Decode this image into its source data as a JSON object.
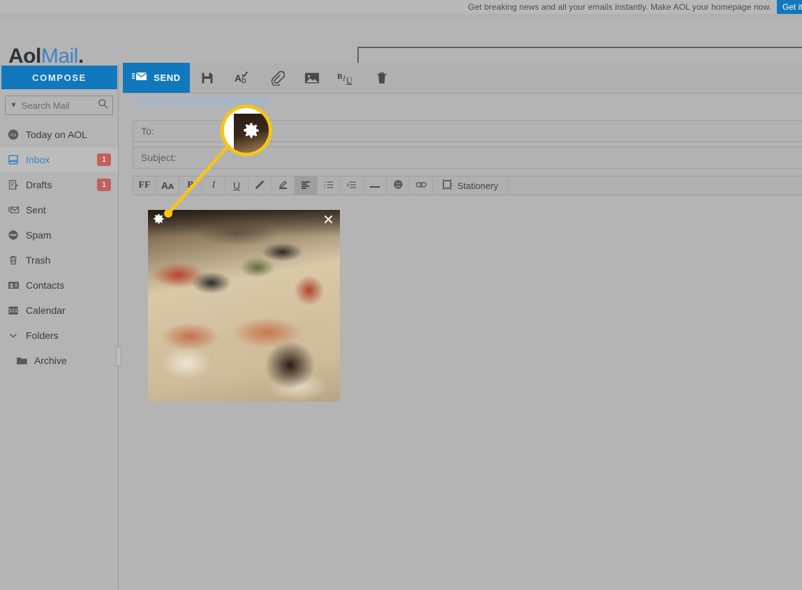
{
  "promo": {
    "text": "Get breaking news and all your emails instantly. Make AOL your homepage now.",
    "button_label": "Get it now",
    "button_color": "#1278bd"
  },
  "brand": {
    "name_primary": "Aol",
    "name_secondary": "Mail",
    "period": ".",
    "accent_color": "#3f83c6"
  },
  "header": {
    "search_value": "",
    "search_placeholder": ""
  },
  "sidebar": {
    "compose_label": "COMPOSE",
    "search": {
      "placeholder": "Search Mail",
      "value": "",
      "chevron": "chevron-down-icon",
      "icon": "search-icon"
    },
    "items": [
      {
        "label": "Today on AOL",
        "icon": "aol-circle-icon",
        "badge": "",
        "active": false
      },
      {
        "label": "Inbox",
        "icon": "inbox-icon",
        "badge": "1",
        "active": true
      },
      {
        "label": "Drafts",
        "icon": "drafts-icon",
        "badge": "1",
        "active": false
      },
      {
        "label": "Sent",
        "icon": "sent-icon",
        "badge": "",
        "active": false
      },
      {
        "label": "Spam",
        "icon": "spam-icon",
        "badge": "",
        "active": false
      },
      {
        "label": "Trash",
        "icon": "trash-icon",
        "badge": "",
        "active": false
      },
      {
        "label": "Contacts",
        "icon": "contacts-icon",
        "badge": "",
        "active": false
      },
      {
        "label": "Calendar",
        "icon": "calendar-icon",
        "badge": "",
        "active": false
      },
      {
        "label": "Folders",
        "icon": "chevron-down-icon",
        "badge": "",
        "active": false
      },
      {
        "label": "Archive",
        "icon": "folder-icon",
        "badge": "",
        "active": false
      }
    ],
    "badge_color": "#c0605f"
  },
  "compose_toolbar": {
    "send_label": "SEND",
    "send_icon": "send-envelope-icon",
    "buttons": [
      {
        "name": "save-draft-button",
        "icon": "floppy-disk-icon",
        "glyph": "💾"
      },
      {
        "name": "spellcheck-button",
        "icon": "spellcheck-icon",
        "glyph": "Ab"
      },
      {
        "name": "attach-file-button",
        "icon": "paperclip-icon",
        "glyph": "📎"
      },
      {
        "name": "insert-image-button",
        "icon": "image-icon",
        "glyph": "🖼"
      },
      {
        "name": "text-format-button",
        "icon": "bold-italic-underline-icon",
        "glyph": "B/U"
      },
      {
        "name": "delete-draft-button",
        "icon": "trash-icon",
        "glyph": "🗑"
      }
    ]
  },
  "compose": {
    "to_label": "To:",
    "to_value": "",
    "subject_label": "Subject:",
    "subject_value": "",
    "from_redacted": true
  },
  "format_toolbar": {
    "buttons": [
      {
        "name": "font-family-button",
        "label": "FF",
        "icon": "font-family-icon",
        "active": false
      },
      {
        "name": "font-size-button",
        "label": "Aᴀ",
        "icon": "font-size-icon",
        "active": false
      },
      {
        "name": "bold-button",
        "label": "B",
        "icon": "bold-icon",
        "active": false
      },
      {
        "name": "italic-button",
        "label": "I",
        "icon": "italic-icon",
        "active": false
      },
      {
        "name": "underline-button",
        "label": "U",
        "icon": "underline-icon",
        "active": false
      },
      {
        "name": "text-color-button",
        "label": "✐",
        "icon": "pencil-icon",
        "active": false
      },
      {
        "name": "highlight-button",
        "label": "╱",
        "icon": "highlighter-icon",
        "active": false
      },
      {
        "name": "align-button",
        "label": "≡",
        "icon": "align-left-icon",
        "active": true
      },
      {
        "name": "list-button",
        "label": "≔",
        "icon": "numbered-list-icon",
        "active": false
      },
      {
        "name": "indent-button",
        "label": "⇥",
        "icon": "indent-icon",
        "active": false
      },
      {
        "name": "horizontal-rule-button",
        "label": "—",
        "icon": "horizontal-rule-icon",
        "active": false
      },
      {
        "name": "emoji-button",
        "label": "☺",
        "icon": "emoji-icon",
        "active": false
      },
      {
        "name": "link-button",
        "label": "⚭",
        "icon": "link-icon",
        "active": false
      }
    ],
    "stationery_label": "Stationery",
    "stationery_icon": "stationery-frame-icon"
  },
  "body": {
    "image": {
      "alt": "pile of folded quilts and blankets on a bed",
      "gear_icon": "gear-icon",
      "close_icon": "close-icon"
    }
  },
  "callout": {
    "color": "#f5c518",
    "magnified_icon": "gear-icon",
    "target": "image-settings-gear"
  }
}
